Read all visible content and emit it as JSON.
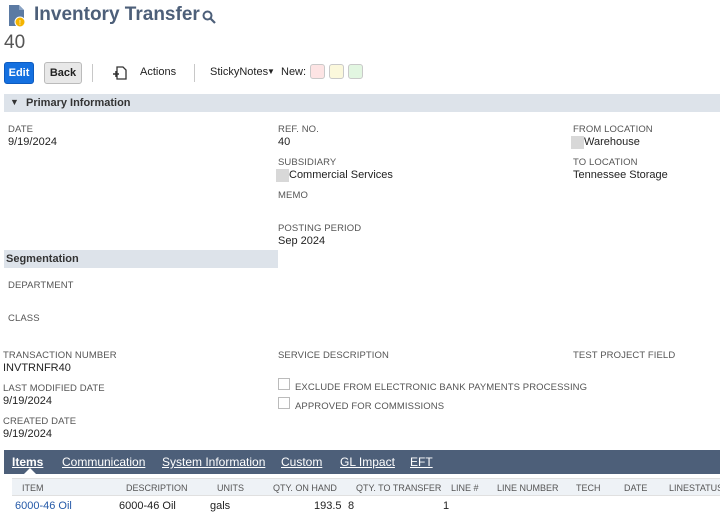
{
  "header": {
    "title": "Inventory Transfer",
    "record_number": "40"
  },
  "toolbar": {
    "edit_label": "Edit",
    "back_label": "Back",
    "actions_label": "Actions",
    "sticky_label": "StickyNotes",
    "new_label": "New:",
    "note_colors": [
      "#fde4e4",
      "#fbf8dc",
      "#e2f6e1"
    ]
  },
  "primary": {
    "section_title": "Primary Information",
    "date_label": "DATE",
    "date_value": "9/19/2024",
    "ref_label": "REF. NO.",
    "ref_value": "40",
    "subsidiary_label": "SUBSIDIARY",
    "subsidiary_value": "Commercial Services",
    "memo_label": "MEMO",
    "posting_label": "POSTING PERIOD",
    "posting_value": "Sep 2024",
    "from_label": "FROM LOCATION",
    "from_value": "Warehouse",
    "to_label": "TO LOCATION",
    "to_value": "Tennessee Storage"
  },
  "segmentation": {
    "section_title": "Segmentation",
    "department_label": "DEPARTMENT",
    "class_label": "CLASS"
  },
  "details": {
    "txn_label": "TRANSACTION NUMBER",
    "txn_value": "INVTRNFR40",
    "lastmod_label": "LAST MODIFIED DATE",
    "lastmod_value": "9/19/2024",
    "created_label": "CREATED DATE",
    "created_value": "9/19/2024",
    "service_label": "SERVICE DESCRIPTION",
    "exclude_label": "EXCLUDE FROM ELECTRONIC BANK PAYMENTS PROCESSING",
    "approved_label": "APPROVED FOR COMMISSIONS",
    "test_label": "TEST PROJECT FIELD"
  },
  "tabs": [
    "Items",
    "Communication",
    "System Information",
    "Custom",
    "GL Impact",
    "EFT"
  ],
  "items_table": {
    "headers": [
      "ITEM",
      "DESCRIPTION",
      "UNITS",
      "QTY. ON HAND",
      "QTY. TO TRANSFER",
      "LINE #",
      "LINE NUMBER",
      "TECH",
      "DATE",
      "LINESTATUS"
    ],
    "rows": [
      [
        "6000-46 Oil",
        "6000-46 Oil",
        "gals",
        "193.5",
        "8",
        "1",
        "",
        "",
        "",
        ""
      ]
    ]
  },
  "colors": {
    "primary_button": "#1470e0",
    "title_color": "#4d5f79",
    "tab_bar": "#4d5f79",
    "section_bar": "#dde3ea",
    "link": "#255aa8"
  }
}
